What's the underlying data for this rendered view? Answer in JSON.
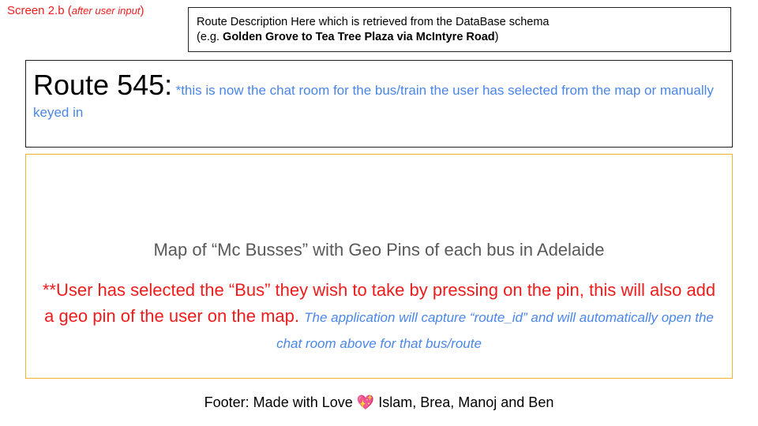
{
  "screen_label": {
    "main": "Screen 2.b (",
    "note": "after user input",
    "close": ")"
  },
  "route_description": {
    "line1": "Route Description Here which is retrieved from the DataBase schema",
    "line2_prefix": "(e.g. ",
    "example": "Golden Grove to Tea Tree Plaza via McIntyre Road",
    "line2_suffix": ")"
  },
  "route_header": {
    "title": "Route 545:",
    "note": "*this is now the chat room for the bus/train the user has selected from the map or manually keyed in"
  },
  "map": {
    "title": "Map of “Mc Busses” with Geo Pins of each bus in Adelaide",
    "selection_note": "**User has selected the “Bus” they wish to take by pressing on the pin, this will also add a geo pin of the user on the map.",
    "capture_note": "The application will capture “route_id” and will automatically open the chat room above for that bus/route"
  },
  "footer": {
    "prefix": "Footer: Made with Love",
    "heart": "💖",
    "names": "Islam, Brea, Manoj and Ben"
  },
  "colors": {
    "accent_red": "#ee1c1c",
    "accent_blue": "#4a86e8",
    "map_border": "#f0b429"
  }
}
